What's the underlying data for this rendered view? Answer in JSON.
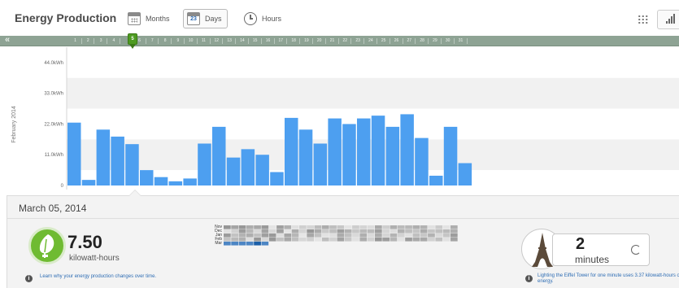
{
  "header": {
    "title": "Energy Production",
    "tabs": [
      {
        "label": "Months",
        "icon": "calendar-icon",
        "active": false
      },
      {
        "label": "Days",
        "icon": "calendar-day-icon",
        "active": true,
        "badge": "23"
      },
      {
        "label": "Hours",
        "icon": "clock-icon",
        "active": false
      }
    ],
    "view_icons": [
      "grid-view-icon",
      "bar-chart-view-icon"
    ]
  },
  "timeline": {
    "prev_label": "«",
    "days": [
      "1",
      "2",
      "3",
      "4",
      "5",
      "6",
      "7",
      "8",
      "9",
      "10",
      "11",
      "12",
      "13",
      "14",
      "15",
      "16",
      "17",
      "18",
      "19",
      "20",
      "21",
      "22",
      "23",
      "24",
      "25",
      "26",
      "27",
      "28",
      "29",
      "30",
      "31"
    ],
    "selected_day": "5",
    "selected_color": "#4d9a21"
  },
  "chart_data": {
    "type": "bar",
    "ylabel": "February 2014",
    "yticks": [
      "0",
      "11.0kWh",
      "22.0kWh",
      "33.0kWh",
      "44.0kWh"
    ],
    "ylim": [
      0,
      49.5
    ],
    "categories": [
      "1",
      "2",
      "3",
      "4",
      "5",
      "6",
      "7",
      "8",
      "9",
      "10",
      "11",
      "12",
      "13",
      "14",
      "15",
      "16",
      "17",
      "18",
      "19",
      "20",
      "21",
      "22",
      "23",
      "24",
      "25",
      "26",
      "27",
      "28"
    ],
    "values": [
      22.5,
      2,
      20,
      17.5,
      14.8,
      5.5,
      3,
      1.5,
      2.5,
      15,
      21,
      10,
      13,
      11,
      4.8,
      24.2,
      20,
      15,
      24,
      22,
      24,
      25,
      21,
      25.5,
      17,
      3.5,
      21,
      8
    ],
    "selected_index": 4,
    "bar_color": "#4d9ff0",
    "grid": true
  },
  "detail": {
    "date": "March 05, 2014",
    "value": "7.50",
    "unit": "kilowatt-hours",
    "learn_text": "Learn why your energy production changes over time.",
    "heatmap_rows": [
      "Nov",
      "Dec",
      "Jan",
      "Feb",
      "Mar"
    ],
    "minutes_value": "2",
    "minutes_unit": "minutes",
    "eiffel_text": "Lighting the Eiffel Tower for one minute uses 3.37 kilowatt-hours of energy."
  }
}
